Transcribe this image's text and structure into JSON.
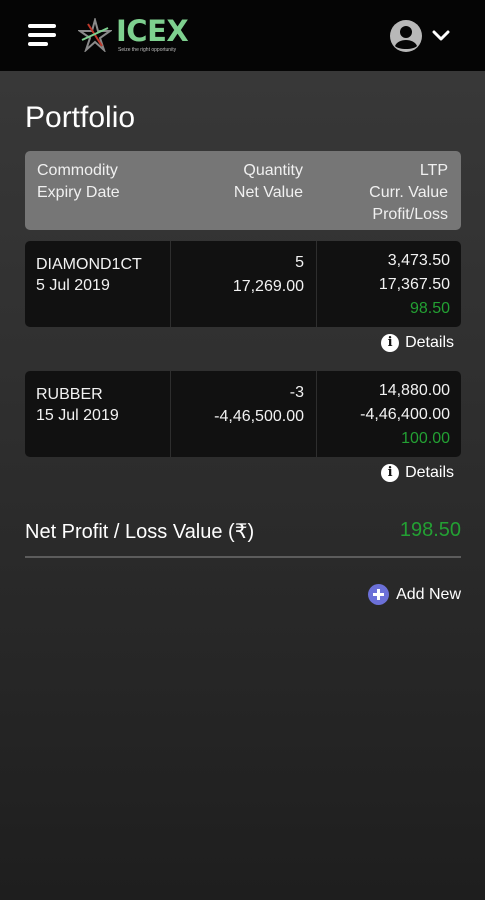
{
  "header": {
    "logo_text": "ICEX",
    "logo_tagline": "Seize the right opportunity"
  },
  "page": {
    "title": "Portfolio"
  },
  "table_header": {
    "col1": [
      "Commodity",
      "Expiry Date"
    ],
    "col2": [
      "Quantity",
      "Net Value"
    ],
    "col3": [
      "LTP",
      "Curr. Value",
      "Profit/Loss"
    ]
  },
  "rows": [
    {
      "commodity": "DIAMOND1CT",
      "expiry": "5 Jul 2019",
      "quantity": "5",
      "net_value": "17,269.00",
      "ltp": "3,473.50",
      "curr_value": "17,367.50",
      "profit_loss": "98.50",
      "details_label": "Details"
    },
    {
      "commodity": "RUBBER",
      "expiry": "15 Jul 2019",
      "quantity": "-3",
      "net_value": "-4,46,500.00",
      "ltp": "14,880.00",
      "curr_value": "-4,46,400.00",
      "profit_loss": "100.00",
      "details_label": "Details"
    }
  ],
  "summary": {
    "net_label": "Net Profit / Loss Value (₹)",
    "net_value": "198.50"
  },
  "actions": {
    "add_new_label": "Add New"
  },
  "colors": {
    "profit": "#23a033",
    "logo": "#7ed08f",
    "add_button": "#6b70d8"
  },
  "icons": {
    "menu": "hamburger-menu-icon",
    "user": "user-avatar-icon",
    "dropdown": "chevron-down-icon",
    "info": "info-icon",
    "add": "plus-circle-icon"
  }
}
